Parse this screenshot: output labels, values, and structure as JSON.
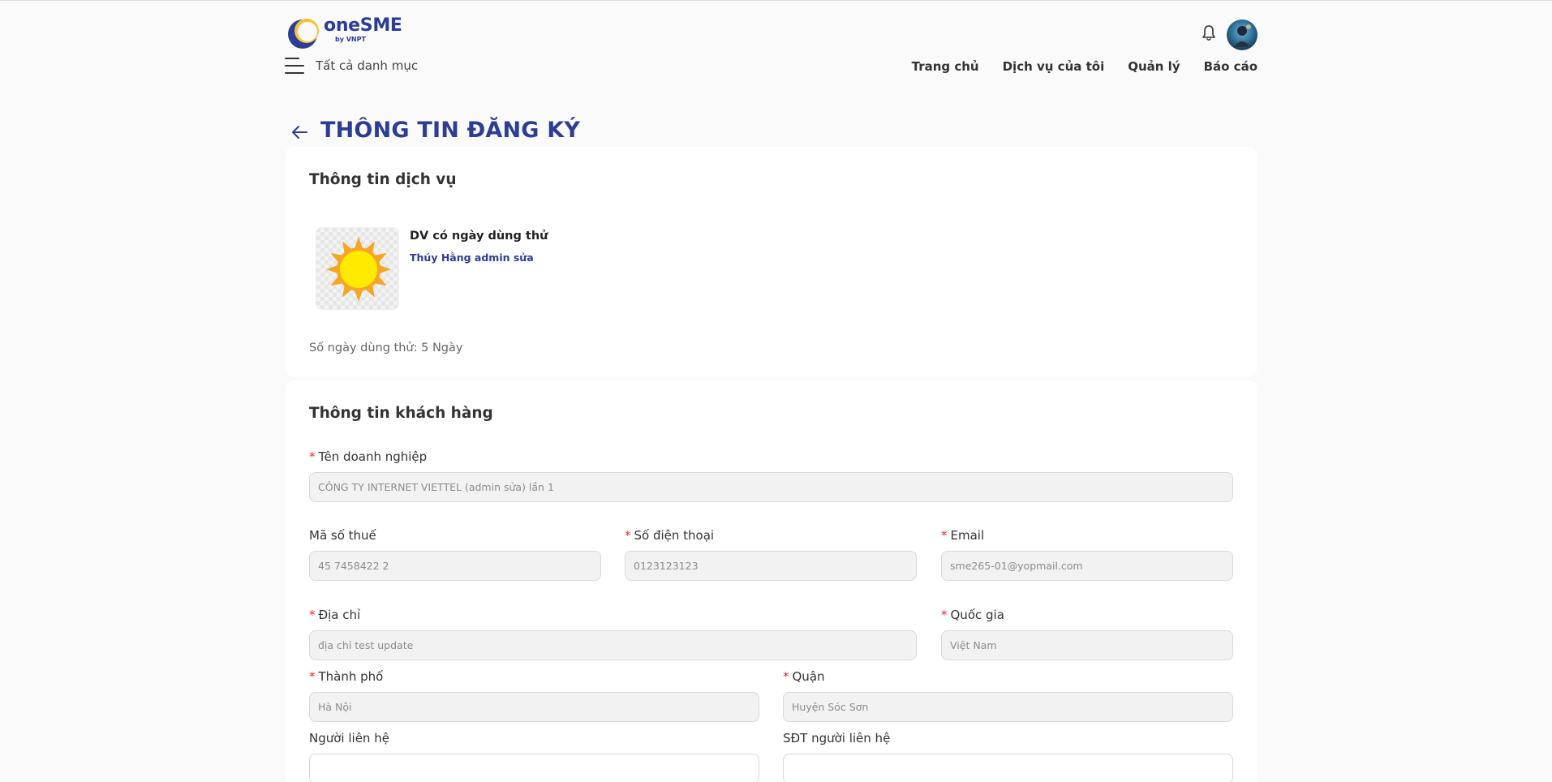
{
  "header": {
    "logo_name": "oneSME",
    "logo_sub": "by VNPT",
    "menu_label": "Tất cả danh mục",
    "nav": [
      "Trang chủ",
      "Dịch vụ của tôi",
      "Quản lý",
      "Báo cáo"
    ]
  },
  "page_title": "THÔNG TIN ĐĂNG KÝ",
  "service_section": {
    "title": "Thông tin dịch vụ",
    "service_name": "DV có ngày dùng thử",
    "provider": "Thúy Hằng admin sửa",
    "trial_label": "Số ngày dùng thử:",
    "trial_value": "5 Ngày"
  },
  "customer_section": {
    "title": "Thông tin khách hàng",
    "fields": {
      "company": {
        "label": "Tên doanh nghiệp",
        "value": "CÔNG TY INTERNET VIETTEL (admin sửa) lần 1",
        "required": true
      },
      "tax": {
        "label": "Mã số thuế",
        "value": "45 7458422 2",
        "required": false
      },
      "phone": {
        "label": "Số điện thoại",
        "value": "0123123123",
        "required": true
      },
      "email": {
        "label": "Email",
        "value": "sme265-01@yopmail.com",
        "required": true
      },
      "address": {
        "label": "Địa chỉ",
        "value": "địa chỉ test update",
        "required": true
      },
      "country": {
        "label": "Quốc gia",
        "value": "Việt Nam",
        "required": true
      },
      "city": {
        "label": "Thành phố",
        "value": "Hà Nội",
        "required": true
      },
      "district": {
        "label": "Quận",
        "value": "Huyện Sóc Sơn",
        "required": true
      },
      "contact": {
        "label": "Người liên hệ",
        "value": "",
        "required": false
      },
      "contact_phone": {
        "label": "SĐT người liên hệ",
        "value": "",
        "required": false
      }
    }
  },
  "required_mark": "*",
  "colors": {
    "brand": "#2c3d94",
    "logo_accent": "#f7c23b",
    "required": "#f5222d"
  },
  "icons": {
    "notification": "bell-icon",
    "back": "arrow-left-icon",
    "menu": "hamburger-icon",
    "service_image": "sun-icon"
  }
}
